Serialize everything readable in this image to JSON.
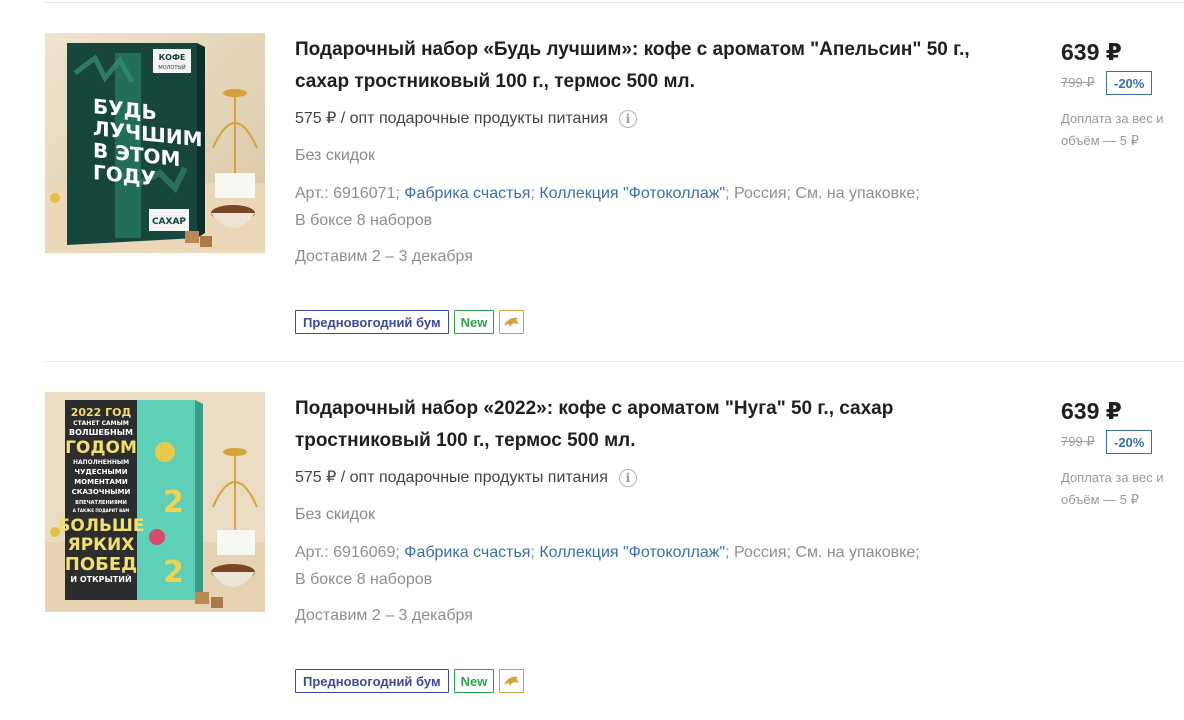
{
  "products": [
    {
      "title": "Подарочный набор «Будь лучшим»: кофе с ароматом \"Апельсин\" 50 г., сахар тростниковый 100 г., термос 500 мл.",
      "wholesale": "575 ₽ / опт подарочные продукты питания",
      "no_discount": "Без скидок",
      "article": "Арт.: 6916071;",
      "brand": "Фабрика счастья",
      "brand_sep": ";",
      "collection": "Коллекция \"Фотоколлаж\"",
      "collection_sep": ";",
      "country": "Россия;",
      "composition": "См. на упаковке;",
      "box": "В боксе 8 наборов",
      "delivery": "Доставим 2 – 3 декабря",
      "badge_promo": "Предновогодний бум",
      "badge_new": "New",
      "price": "639 ₽",
      "old_price": "799 ₽",
      "discount": "-20%",
      "surcharge": "Доплата за вес и объём — 5 ₽",
      "image_text": [
        "БУДЬ",
        "ЛУЧШИМ",
        "В ЭТОМ",
        "ГОДУ"
      ],
      "image_small": [
        "КОФЕ",
        "МОЛОТЫЙ"
      ],
      "image_bottom": "САХАР"
    },
    {
      "title": "Подарочный набор «2022»: кофе с ароматом \"Нуга\" 50 г., сахар тростниковый 100 г., термос 500 мл.",
      "wholesale": "575 ₽ / опт подарочные продукты питания",
      "no_discount": "Без скидок",
      "article": "Арт.: 6916069;",
      "brand": "Фабрика счастья",
      "brand_sep": ";",
      "collection": "Коллекция \"Фотоколлаж\"",
      "collection_sep": ";",
      "country": "Россия;",
      "composition": "См. на упаковке;",
      "box": "В боксе 8 наборов",
      "delivery": "Доставим 2 – 3 декабря",
      "badge_promo": "Предновогодний бум",
      "badge_new": "New",
      "price": "639 ₽",
      "old_price": "799 ₽",
      "discount": "-20%",
      "surcharge": "Доплата за вес и объём — 5 ₽",
      "image_text": [
        "2022 ГОД",
        "СТАНЕТ САМЫМ",
        "ВОЛШЕБНЫМ",
        "ГОДОМ",
        "НАПОЛНЕННЫМ",
        "ЧУДЕСНЫМИ",
        "МОМЕНТАМИ",
        "СКАЗОЧНЫМИ",
        "ВПЕЧАТЛЕНИЯМИ",
        "А ТАКЖЕ ПОДАРИТ ВАМ",
        "БОЛЬШЕ",
        "ЯРКИХ",
        "ПОБЕД",
        "И ОТКРЫТИЙ"
      ]
    }
  ],
  "colors": {
    "link": "#3a6fb0",
    "promo": "#3b4a9c",
    "new": "#2ea44f",
    "dolphin": "#d3a23a"
  },
  "icons": {
    "info": "info-icon",
    "dolphin": "dolphin-icon"
  }
}
